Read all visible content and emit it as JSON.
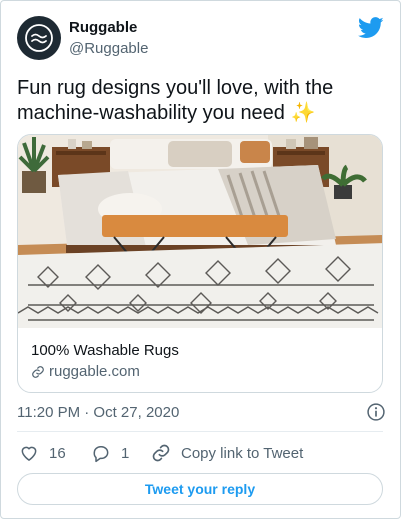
{
  "author": {
    "name": "Ruggable",
    "handle": "@Ruggable",
    "avatar_icon": "ruggable-wave-logo"
  },
  "tweet": {
    "text": "Fun rug designs you'll love, with the machine-washability you need ✨"
  },
  "card": {
    "image_description_icon": "bedroom-rug-photo",
    "title": "100% Washable Rugs",
    "domain": "ruggable.com",
    "domain_icon": "link-icon"
  },
  "meta": {
    "timestamp": "11:20 PM · Oct 27, 2020",
    "info_icon": "info-icon"
  },
  "actions": {
    "likes": "16",
    "replies": "1",
    "copy_link_label": "Copy link to Tweet"
  },
  "reply_button": {
    "label": "Tweet your reply"
  },
  "colors": {
    "brand_blue": "#1d9bf0",
    "text_primary": "#0f1419",
    "text_secondary": "#536471",
    "border": "#cfd9de"
  }
}
